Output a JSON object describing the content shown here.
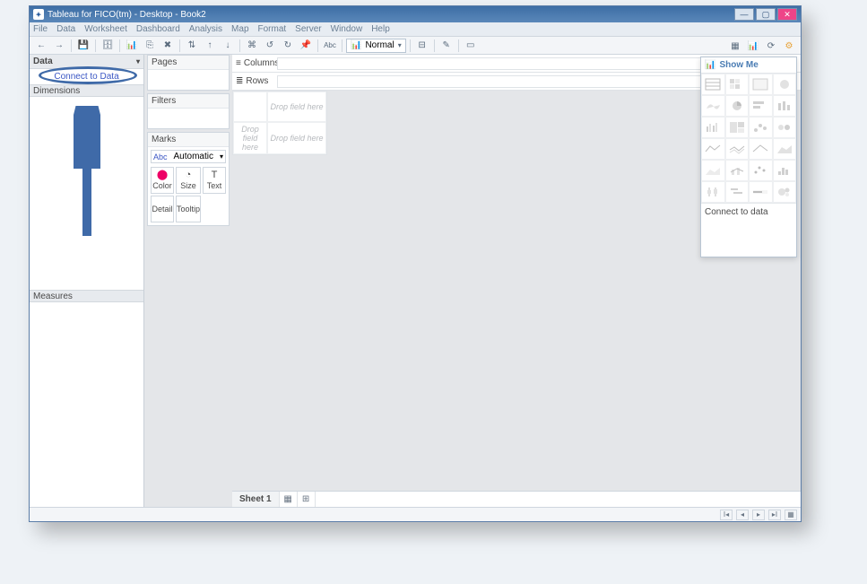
{
  "window": {
    "title": "Tableau for FICO(tm) - Desktop - Book2"
  },
  "menu": {
    "items": [
      "File",
      "Data",
      "Worksheet",
      "Dashboard",
      "Analysis",
      "Map",
      "Format",
      "Server",
      "Window",
      "Help"
    ]
  },
  "data_pane": {
    "header": "Data",
    "connect_link": "Connect to Data",
    "dimensions_header": "Dimensions",
    "measures_header": "Measures"
  },
  "cards": {
    "pages": "Pages",
    "filters": "Filters",
    "marks": "Marks",
    "mark_type_prefix": "Abc",
    "mark_type": "Automatic",
    "cells": {
      "color": "Color",
      "size": "Size",
      "text": "Text",
      "detail": "Detail",
      "tooltip": "Tooltip"
    }
  },
  "shelves": {
    "columns": "Columns",
    "rows": "Rows"
  },
  "canvas": {
    "drop_field": "Drop field here",
    "drop_field2": "Drop field here",
    "drop_field3": "Drop field here"
  },
  "sheet_tabs": {
    "sheet1": "Sheet 1"
  },
  "toolbar": {
    "fit_label": "Normal"
  },
  "showme": {
    "title": "Show Me",
    "message": "Connect to data"
  }
}
